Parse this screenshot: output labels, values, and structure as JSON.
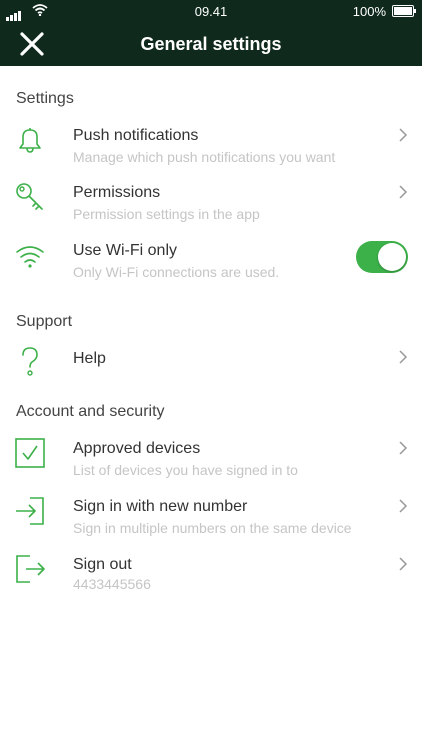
{
  "status_bar": {
    "time": "09.41",
    "battery": "100%"
  },
  "header": {
    "title": "General settings",
    "close_icon": "close-icon"
  },
  "sections": {
    "settings": "Settings",
    "support": "Support",
    "account": "Account and security"
  },
  "rows": {
    "push": {
      "label": "Push notifications",
      "sub": "Manage which push notifications you want",
      "icon": "bell-icon"
    },
    "permissions": {
      "label": "Permissions",
      "sub": "Permission settings in the app",
      "icon": "key-icon"
    },
    "wifi": {
      "label": "Use Wi-Fi only",
      "sub": "Only Wi-Fi connections are used.",
      "icon": "wifi-icon",
      "enabled": true
    },
    "help": {
      "label": "Help",
      "icon": "question-icon"
    },
    "devices": {
      "label": "Approved devices",
      "sub": "List of devices you have signed in to",
      "icon": "checkbox-icon"
    },
    "signin": {
      "label": "Sign in with new number",
      "sub": "Sign in multiple numbers on the same device",
      "icon": "sign-in-icon"
    },
    "signout": {
      "label": "Sign out",
      "sub": "4433445566",
      "icon": "sign-out-icon"
    }
  },
  "colors": {
    "header_bg": "#0f2a1c",
    "accent": "#3cb049"
  }
}
